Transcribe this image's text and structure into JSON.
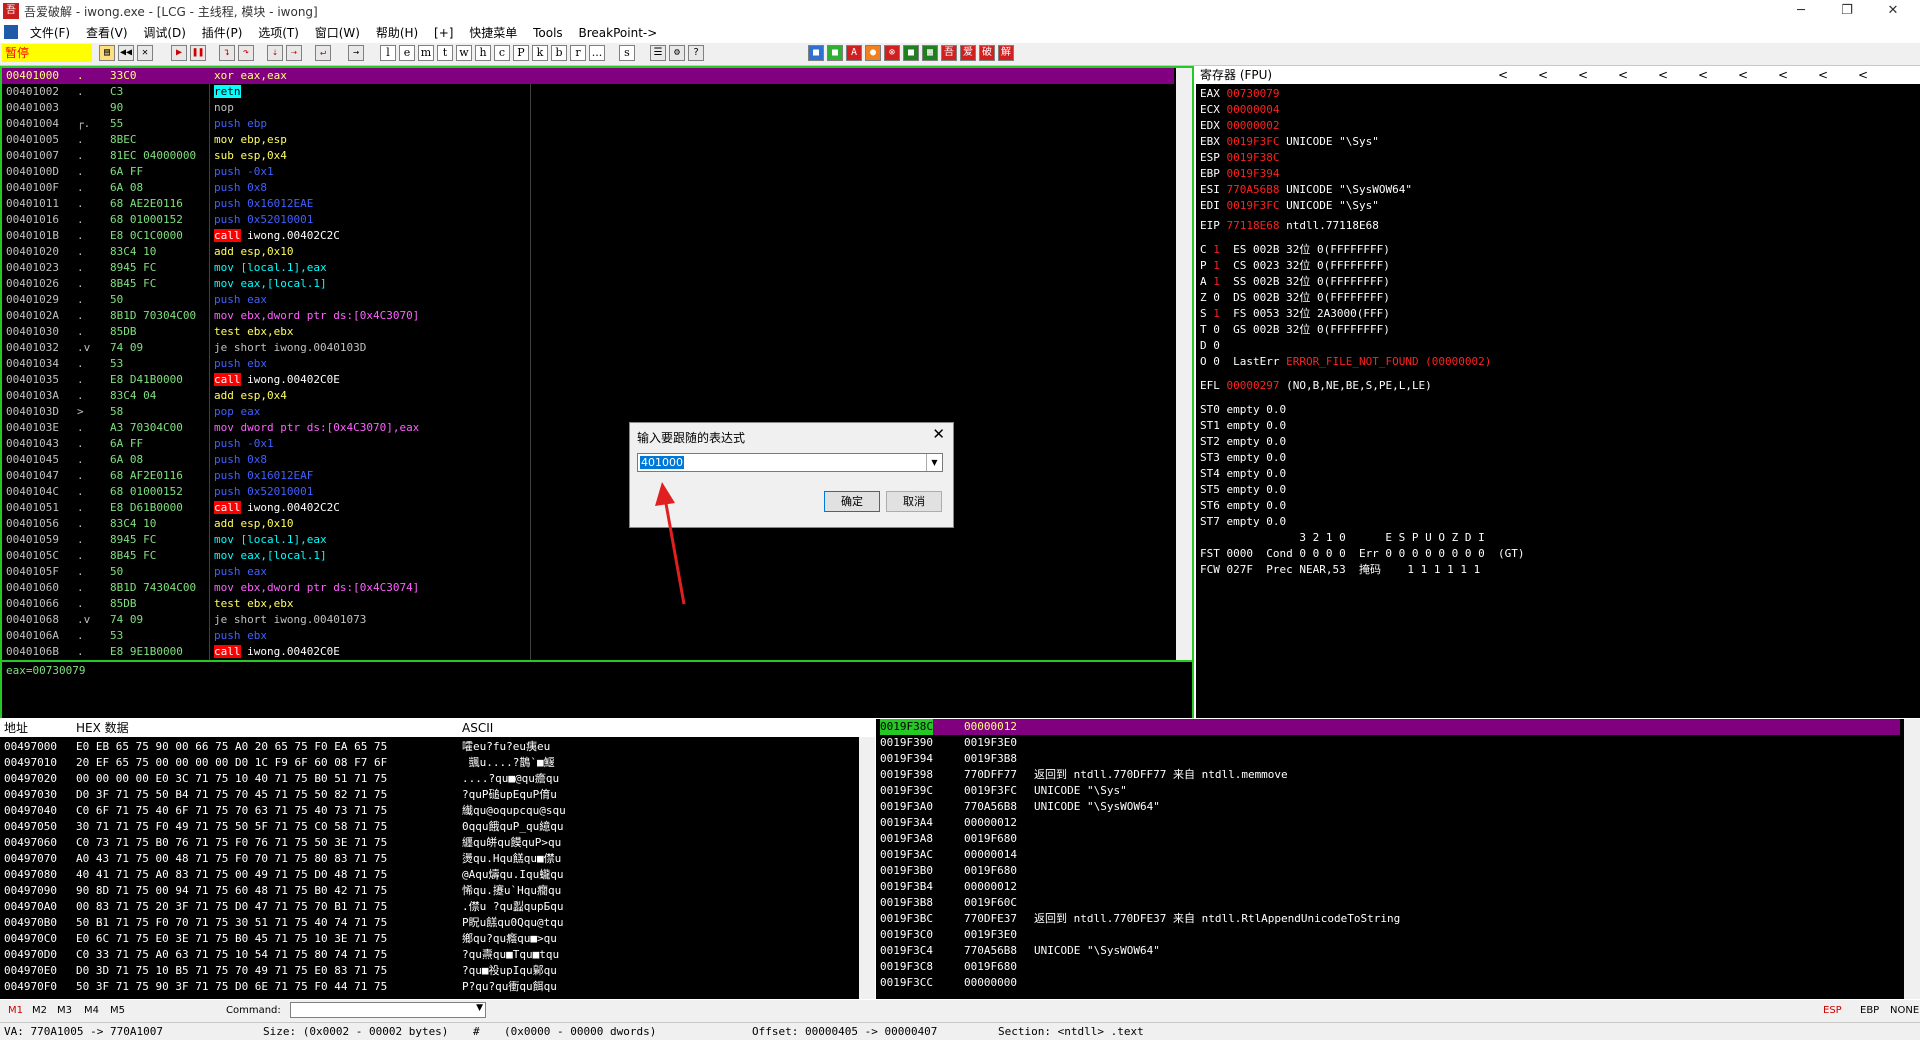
{
  "window": {
    "title": "吾爱破解 - iwong.exe - [LCG - 主线程, 模块 - iwong]",
    "controls": [
      "─",
      "❐",
      "✕"
    ]
  },
  "menu": [
    "文件(F)",
    "查看(V)",
    "调试(D)",
    "插件(P)",
    "选项(T)",
    "窗口(W)",
    "帮助(H)",
    "[+]",
    "快捷菜单",
    "Tools",
    "BreakPoint->"
  ],
  "toolbar": {
    "status": "暂停",
    "letters": [
      "l",
      "e",
      "m",
      "t",
      "w",
      "h",
      "c",
      "P",
      "k",
      "b",
      "r",
      "...",
      "s"
    ]
  },
  "disasm": {
    "rows": [
      {
        "addr": "00401000",
        "mark": ".",
        "hex": "33C0",
        "op": "xor",
        "args": "eax,eax",
        "sel": true
      },
      {
        "addr": "00401002",
        "mark": ".",
        "hex": "C3",
        "op": "retn",
        "args": ""
      },
      {
        "addr": "00401003",
        "mark": "",
        "hex": "90",
        "op": "nop",
        "args": ""
      },
      {
        "addr": "00401004",
        "mark": "┌.",
        "hex": "55",
        "op": "push",
        "args": "ebp"
      },
      {
        "addr": "00401005",
        "mark": ".",
        "hex": "8BEC",
        "op": "mov",
        "args": "ebp,esp"
      },
      {
        "addr": "00401007",
        "mark": ".",
        "hex": "81EC 04000000",
        "op": "sub",
        "args": "esp,0x4"
      },
      {
        "addr": "0040100D",
        "mark": ".",
        "hex": "6A FF",
        "op": "push",
        "args": "-0x1"
      },
      {
        "addr": "0040100F",
        "mark": ".",
        "hex": "6A 08",
        "op": "push",
        "args": "0x8"
      },
      {
        "addr": "00401011",
        "mark": ".",
        "hex": "68 AE2E0116",
        "op": "push",
        "args": "0x16012EAE"
      },
      {
        "addr": "00401016",
        "mark": ".",
        "hex": "68 01000152",
        "op": "push",
        "args": "0x52010001"
      },
      {
        "addr": "0040101B",
        "mark": ".",
        "hex": "E8 0C1C0000",
        "op": "call",
        "args": "iwong.00402C2C"
      },
      {
        "addr": "00401020",
        "mark": ".",
        "hex": "83C4 10",
        "op": "add",
        "args": "esp,0x10"
      },
      {
        "addr": "00401023",
        "mark": ".",
        "hex": "8945 FC",
        "op": "mov",
        "args": "[local.1],eax"
      },
      {
        "addr": "00401026",
        "mark": ".",
        "hex": "8B45 FC",
        "op": "mov",
        "args": "eax,[local.1]"
      },
      {
        "addr": "00401029",
        "mark": ".",
        "hex": "50",
        "op": "push",
        "args": "eax"
      },
      {
        "addr": "0040102A",
        "mark": ".",
        "hex": "8B1D 70304C00",
        "op": "mov",
        "args": "ebx,dword ptr ds:[0x4C3070]"
      },
      {
        "addr": "00401030",
        "mark": ".",
        "hex": "85DB",
        "op": "test",
        "args": "ebx,ebx"
      },
      {
        "addr": "00401032",
        "mark": ".v",
        "hex": "74 09",
        "op": "je",
        "args": "short iwong.0040103D"
      },
      {
        "addr": "00401034",
        "mark": ".",
        "hex": "53",
        "op": "push",
        "args": "ebx"
      },
      {
        "addr": "00401035",
        "mark": ".",
        "hex": "E8 D41B0000",
        "op": "call",
        "args": "iwong.00402C0E"
      },
      {
        "addr": "0040103A",
        "mark": ".",
        "hex": "83C4 04",
        "op": "add",
        "args": "esp,0x4"
      },
      {
        "addr": "0040103D",
        "mark": ">",
        "hex": "58",
        "op": "pop",
        "args": "eax"
      },
      {
        "addr": "0040103E",
        "mark": ".",
        "hex": "A3 70304C00",
        "op": "mov",
        "args": "dword ptr ds:[0x4C3070],eax"
      },
      {
        "addr": "00401043",
        "mark": ".",
        "hex": "6A FF",
        "op": "push",
        "args": "-0x1"
      },
      {
        "addr": "00401045",
        "mark": ".",
        "hex": "6A 08",
        "op": "push",
        "args": "0x8"
      },
      {
        "addr": "00401047",
        "mark": ".",
        "hex": "68 AF2E0116",
        "op": "push",
        "args": "0x16012EAF"
      },
      {
        "addr": "0040104C",
        "mark": ".",
        "hex": "68 01000152",
        "op": "push",
        "args": "0x52010001"
      },
      {
        "addr": "00401051",
        "mark": ".",
        "hex": "E8 D61B0000",
        "op": "call",
        "args": "iwong.00402C2C"
      },
      {
        "addr": "00401056",
        "mark": ".",
        "hex": "83C4 10",
        "op": "add",
        "args": "esp,0x10"
      },
      {
        "addr": "00401059",
        "mark": ".",
        "hex": "8945 FC",
        "op": "mov",
        "args": "[local.1],eax"
      },
      {
        "addr": "0040105C",
        "mark": ".",
        "hex": "8B45 FC",
        "op": "mov",
        "args": "eax,[local.1]"
      },
      {
        "addr": "0040105F",
        "mark": ".",
        "hex": "50",
        "op": "push",
        "args": "eax"
      },
      {
        "addr": "00401060",
        "mark": ".",
        "hex": "8B1D 74304C00",
        "op": "mov",
        "args": "ebx,dword ptr ds:[0x4C3074]"
      },
      {
        "addr": "00401066",
        "mark": ".",
        "hex": "85DB",
        "op": "test",
        "args": "ebx,ebx"
      },
      {
        "addr": "00401068",
        "mark": ".v",
        "hex": "74 09",
        "op": "je",
        "args": "short iwong.00401073"
      },
      {
        "addr": "0040106A",
        "mark": ".",
        "hex": "53",
        "op": "push",
        "args": "ebx"
      },
      {
        "addr": "0040106B",
        "mark": ".",
        "hex": "E8 9E1B0000",
        "op": "call",
        "args": "iwong.00402C0E"
      }
    ],
    "info": "eax=00730079"
  },
  "registers": {
    "header": "寄存器 (FPU)",
    "nav": [
      "<",
      "<",
      "<",
      "<",
      "<",
      "<",
      "<",
      "<",
      "<",
      "<"
    ],
    "gp": [
      {
        "name": "EAX",
        "val": "00730079",
        "desc": ""
      },
      {
        "name": "ECX",
        "val": "00000004",
        "desc": ""
      },
      {
        "name": "EDX",
        "val": "00000002",
        "desc": ""
      },
      {
        "name": "EBX",
        "val": "0019F3FC",
        "desc": "UNICODE \"\\Sys\""
      },
      {
        "name": "ESP",
        "val": "0019F38C",
        "desc": ""
      },
      {
        "name": "EBP",
        "val": "0019F394",
        "desc": ""
      },
      {
        "name": "ESI",
        "val": "770A56B8",
        "desc": "UNICODE \"\\SysWOW64\""
      },
      {
        "name": "EDI",
        "val": "0019F3FC",
        "desc": "UNICODE \"\\Sys\""
      }
    ],
    "eip": {
      "name": "EIP",
      "val": "77118E68",
      "desc": "ntdll.77118E68"
    },
    "flags": [
      {
        "f": "C",
        "v": "1",
        "seg": "ES 002B 32位 0(FFFFFFFF)"
      },
      {
        "f": "P",
        "v": "1",
        "seg": "CS 0023 32位 0(FFFFFFFF)"
      },
      {
        "f": "A",
        "v": "1",
        "seg": "SS 002B 32位 0(FFFFFFFF)"
      },
      {
        "f": "Z",
        "v": "0",
        "seg": "DS 002B 32位 0(FFFFFFFF)"
      },
      {
        "f": "S",
        "v": "1",
        "seg": "FS 0053 32位 2A3000(FFF)"
      },
      {
        "f": "T",
        "v": "0",
        "seg": "GS 002B 32位 0(FFFFFFFF)"
      },
      {
        "f": "D",
        "v": "0",
        "seg": ""
      },
      {
        "f": "O",
        "v": "0",
        "seg": "LastErr"
      }
    ],
    "lasterr": "ERROR_FILE_NOT_FOUND (00000002)",
    "efl": {
      "name": "EFL",
      "val": "00000297",
      "desc": "(NO,B,NE,BE,S,PE,L,LE)"
    },
    "st": [
      "ST0 empty 0.0",
      "ST1 empty 0.0",
      "ST2 empty 0.0",
      "ST3 empty 0.0",
      "ST4 empty 0.0",
      "ST5 empty 0.0",
      "ST6 empty 0.0",
      "ST7 empty 0.0"
    ],
    "fpu_header": "               3 2 1 0      E S P U O Z D I",
    "fst": "FST 0000  Cond 0 0 0 0  Err 0 0 0 0 0 0 0 0  (GT)",
    "fcw": "FCW 027F  Prec NEAR,53  掩码    1 1 1 1 1 1"
  },
  "dump": {
    "headers": [
      "地址",
      "HEX 数据",
      "ASCII"
    ],
    "rows": [
      {
        "addr": "00497000",
        "hex": "E0 EB 65 75 90 00 66 75 A0 20 65 75 F0 EA 65 75",
        "ascii": "嚯eu?fu?eu痍eu"
      },
      {
        "addr": "00497010",
        "hex": "20 EF 65 75 00 00 00 00 D0 1C F9 6F 60 08 F7 6F",
        "ascii": " 颽u....?鵲`■鰋"
      },
      {
        "addr": "00497020",
        "hex": "00 00 00 00 E0 3C 71 75 10 40 71 75 B0 51 71 75",
        "ascii": "....?qu■@qu癚qu"
      },
      {
        "addr": "00497030",
        "hex": "D0 3F 71 75 50 B4 71 75 70 45 71 75 50 82 71 75",
        "ascii": "?quP磓upEquP俼u"
      },
      {
        "addr": "00497040",
        "hex": "C0 6F 71 75 40 6F 71 75 70 63 71 75 40 73 71 75",
        "ascii": "纎qu@oqupcqu@squ"
      },
      {
        "addr": "00497050",
        "hex": "30 71 71 75 F0 49 71 75 50 5F 71 75 C0 58 71 75",
        "ascii": "0qqu餓quP_qu繶qu"
      },
      {
        "addr": "00497060",
        "hex": "C0 73 71 75 B0 76 71 75 F0 76 71 75 50 3E 71 75",
        "ascii": "纒qu皏qu饃quP>qu"
      },
      {
        "addr": "00497070",
        "hex": "A0 43 71 75 00 48 71 75 F0 70 71 75 80 83 71 75",
        "ascii": "燙qu.Hqu餻qu■僸u"
      },
      {
        "addr": "00497080",
        "hex": "40 41 71 75 A0 83 71 75 00 49 71 75 D0 48 71 75",
        "ascii": "@Aqu燽qu.Iqu蠬qu"
      },
      {
        "addr": "00497090",
        "hex": "90 8D 71 75 00 94 71 75 60 48 71 75 B0 42 71 75",
        "ascii": "悕qu.攓u`Hqu癇qu"
      },
      {
        "addr": "004970A0",
        "hex": "00 83 71 75 20 3F 71 75 D0 47 71 75 70 B1 71 75",
        "ascii": ".僸u ?qu蠫qupБqu"
      },
      {
        "addr": "004970B0",
        "hex": "50 B1 71 75 F0 70 71 75 30 51 71 75 40 74 71 75",
        "ascii": "P眖u餻qu0Qqu@tqu"
      },
      {
        "addr": "004970C0",
        "hex": "E0 6C 71 75 E0 3E 71 75 B0 45 71 75 10 3E 71 75",
        "ascii": "鄉qu?qu癊qu■>qu"
      },
      {
        "addr": "004970D0",
        "hex": "C0 33 71 75 A0 63 71 75 10 54 71 75 80 74 71 75",
        "ascii": "?qu燾qu■Tqu■tqu"
      },
      {
        "addr": "004970E0",
        "hex": "D0 3D 71 75 10 B5 71 75 70 49 71 75 E0 83 71 75",
        "ascii": "?qu■祋upIqu鄡qu"
      },
      {
        "addr": "004970F0",
        "hex": "50 3F 71 75 90 3F 71 75 D0 6E 71 75 F0 44 71 75",
        "ascii": "P?qu?qu衝qu餌qu"
      }
    ]
  },
  "stack": {
    "rows": [
      {
        "addr": "0019F38C",
        "val": "00000012",
        "desc": "",
        "sel": true
      },
      {
        "addr": "0019F390",
        "val": "0019F3E0",
        "desc": ""
      },
      {
        "addr": "0019F394",
        "val": "0019F3B8",
        "desc": ""
      },
      {
        "addr": "0019F398",
        "val": "770DFF77",
        "desc": "返回到 ntdll.770DFF77 来自 ntdll.memmove"
      },
      {
        "addr": "0019F39C",
        "val": "0019F3FC",
        "desc": "UNICODE \"\\Sys\""
      },
      {
        "addr": "0019F3A0",
        "val": "770A56B8",
        "desc": "UNICODE \"\\SysWOW64\""
      },
      {
        "addr": "0019F3A4",
        "val": "00000012",
        "desc": ""
      },
      {
        "addr": "0019F3A8",
        "val": "0019F680",
        "desc": ""
      },
      {
        "addr": "0019F3AC",
        "val": "00000014",
        "desc": ""
      },
      {
        "addr": "0019F3B0",
        "val": "0019F680",
        "desc": ""
      },
      {
        "addr": "0019F3B4",
        "val": "00000012",
        "desc": ""
      },
      {
        "addr": "0019F3B8",
        "val": "0019F60C",
        "desc": ""
      },
      {
        "addr": "0019F3BC",
        "val": "770DFE37",
        "desc": "返回到 ntdll.770DFE37 来自 ntdll.RtlAppendUnicodeToString"
      },
      {
        "addr": "0019F3C0",
        "val": "0019F3E0",
        "desc": ""
      },
      {
        "addr": "0019F3C4",
        "val": "770A56B8",
        "desc": "UNICODE \"\\SysWOW64\""
      },
      {
        "addr": "0019F3C8",
        "val": "0019F680",
        "desc": ""
      },
      {
        "addr": "0019F3CC",
        "val": "00000000",
        "desc": ""
      }
    ]
  },
  "command": {
    "tabs": [
      "M1",
      "M2",
      "M3",
      "M4",
      "M5"
    ],
    "label": "Command:",
    "right": [
      "ESP",
      "EBP",
      "NONE"
    ]
  },
  "status": {
    "va": "VA: 770A1005 -> 770A1007",
    "size": "Size: (0x0002 - 00002 bytes)",
    "hash": "#",
    "dwords": "(0x0000 - 00000 dwords)",
    "offset": "Offset: 00000405 -> 00000407",
    "section": "Section: <ntdll> .text"
  },
  "dialog": {
    "title": "输入要跟随的表达式",
    "value": "401000",
    "ok": "确定",
    "cancel": "取消"
  },
  "colors": {
    "green_border": "#26c826",
    "selection": "#800080",
    "call_bg": "#ff0000",
    "retn_bg": "#00ffff",
    "push_pop": "#4060ff",
    "jump": "#c0c0c0",
    "accent_red": "#ff2020"
  }
}
